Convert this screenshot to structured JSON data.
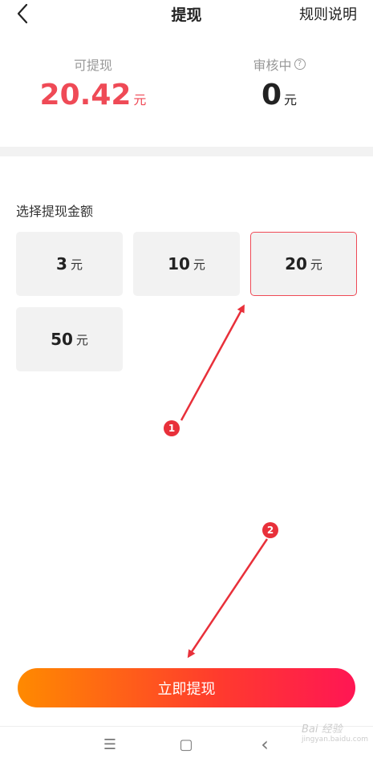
{
  "header": {
    "title": "提现",
    "rules_link": "规则说明",
    "back_icon": "chevron-left-icon"
  },
  "balance": {
    "withdrawable_label": "可提现",
    "withdrawable_value": "20.42",
    "withdrawable_unit": "元",
    "reviewing_label": "审核中",
    "reviewing_help": "?",
    "reviewing_value": "0",
    "reviewing_unit": "元"
  },
  "amount_section": {
    "label": "选择提现金额",
    "options": [
      {
        "value": "3",
        "unit": "元",
        "selected": false
      },
      {
        "value": "10",
        "unit": "元",
        "selected": false
      },
      {
        "value": "20",
        "unit": "元",
        "selected": true
      },
      {
        "value": "50",
        "unit": "元",
        "selected": false
      }
    ]
  },
  "annotations": {
    "badge1": "1",
    "badge2": "2"
  },
  "submit": {
    "label": "立即提现"
  },
  "navbar": {
    "menu": "☰",
    "home": "▢",
    "back": "‹"
  },
  "watermark": {
    "text": "Bai 经验",
    "sub": "jingyan.baidu.com"
  },
  "colors": {
    "accent": "#ef4a56",
    "gradient_start": "#ff8a00",
    "gradient_end": "#ff1654",
    "annotation": "#e8303a"
  }
}
